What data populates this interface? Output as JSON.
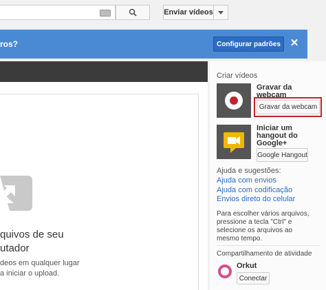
{
  "header": {
    "upload_label": "Enviar vídeos"
  },
  "banner": {
    "text": "ros?",
    "config_button": "Configurar padrões",
    "close": "✕"
  },
  "dropzone": {
    "title_line1": "quivos de seu",
    "title_line2": "utador",
    "sub_line1": "deos em qualquer lugar",
    "sub_line2": "a iniciar o upload."
  },
  "sidebar": {
    "create_title": "Criar vídeos",
    "webcam": {
      "title": "Gravar da webcam",
      "button": "Gravar da webcam"
    },
    "hangout": {
      "title": "Iniciar um hangout do Google+",
      "button": "Google Hangout"
    },
    "help": {
      "title": "Ajuda e sugestões:",
      "links": [
        "Ajuda com envios",
        "Ajuda com codificação",
        "Envios direto do celular"
      ]
    },
    "tip": "Para escolher vários arquivos, pressione a tecla \"Ctrl\" e selecione os arquivos ao mesmo tempo.",
    "share": {
      "title": "Compartilhamento de atividade",
      "service": "Orkut",
      "button": "Conectar"
    }
  },
  "colors": {
    "banner": "#4a8ad4",
    "accent_red": "#c0242e",
    "link": "#2a6bcb",
    "hangout": "#f1b800"
  }
}
